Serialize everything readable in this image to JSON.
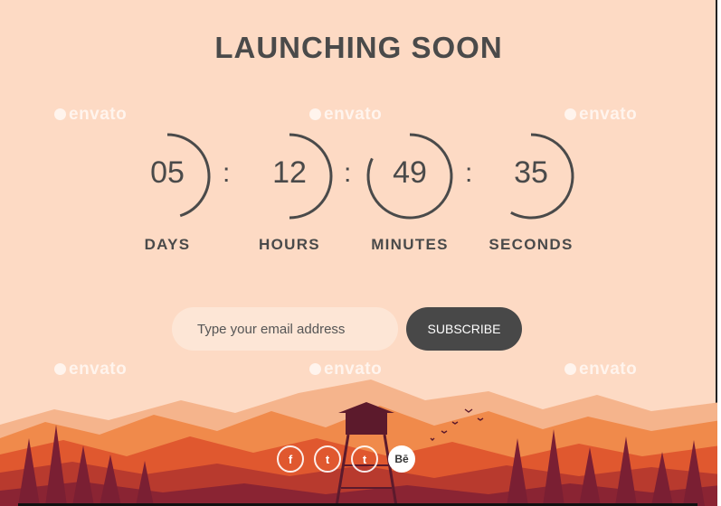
{
  "page": {
    "title": "LAUNCHING SOON"
  },
  "watermark": {
    "text": "envato"
  },
  "countdown": {
    "units": [
      {
        "value": "05",
        "label": "DAYS",
        "progress": 0.45
      },
      {
        "value": "12",
        "label": "HOURS",
        "progress": 0.5
      },
      {
        "value": "49",
        "label": "MINUTES",
        "progress": 0.82
      },
      {
        "value": "35",
        "label": "SECONDS",
        "progress": 0.58
      }
    ],
    "separator": ":"
  },
  "subscribe": {
    "email_placeholder": "Type your email address",
    "email_value": "",
    "button_label": "SUBSCRIBE"
  },
  "social": [
    {
      "icon": "facebook-icon",
      "glyph": "f"
    },
    {
      "icon": "twitter-icon",
      "glyph": "t"
    },
    {
      "icon": "tumblr-icon",
      "glyph": "t"
    },
    {
      "icon": "behance-icon",
      "glyph": "Bē"
    }
  ],
  "colors": {
    "background": "#fddac4",
    "text": "#4a4a4a",
    "button": "#484848",
    "input": "#fde6d6"
  }
}
